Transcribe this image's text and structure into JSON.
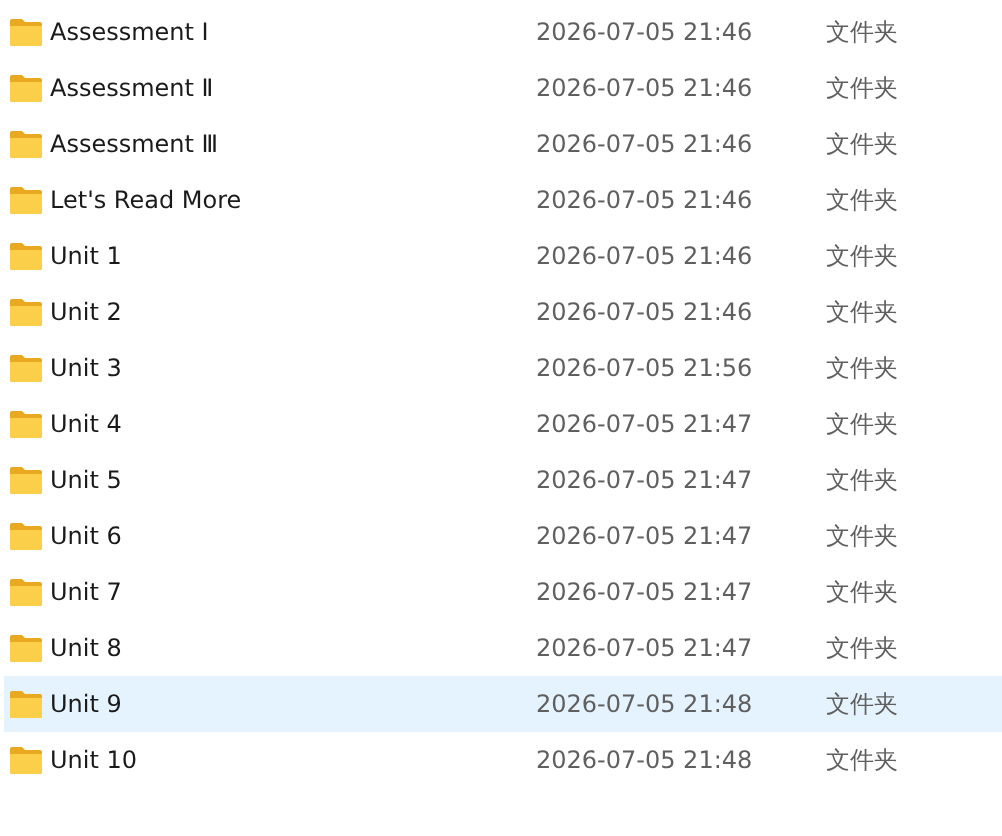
{
  "files": [
    {
      "name": "Assessment Ⅰ",
      "modified": "2026-07-05 21:46",
      "type": "文件夹",
      "selected": false
    },
    {
      "name": "Assessment Ⅱ",
      "modified": "2026-07-05 21:46",
      "type": "文件夹",
      "selected": false
    },
    {
      "name": "Assessment Ⅲ",
      "modified": "2026-07-05 21:46",
      "type": "文件夹",
      "selected": false
    },
    {
      "name": "Let's Read More",
      "modified": "2026-07-05 21:46",
      "type": "文件夹",
      "selected": false
    },
    {
      "name": "Unit 1",
      "modified": "2026-07-05 21:46",
      "type": "文件夹",
      "selected": false
    },
    {
      "name": "Unit 2",
      "modified": "2026-07-05 21:46",
      "type": "文件夹",
      "selected": false
    },
    {
      "name": "Unit 3",
      "modified": "2026-07-05 21:56",
      "type": "文件夹",
      "selected": false
    },
    {
      "name": "Unit 4",
      "modified": "2026-07-05 21:47",
      "type": "文件夹",
      "selected": false
    },
    {
      "name": "Unit 5",
      "modified": "2026-07-05 21:47",
      "type": "文件夹",
      "selected": false
    },
    {
      "name": "Unit 6",
      "modified": "2026-07-05 21:47",
      "type": "文件夹",
      "selected": false
    },
    {
      "name": "Unit 7",
      "modified": "2026-07-05 21:47",
      "type": "文件夹",
      "selected": false
    },
    {
      "name": "Unit 8",
      "modified": "2026-07-05 21:47",
      "type": "文件夹",
      "selected": false
    },
    {
      "name": "Unit 9",
      "modified": "2026-07-05 21:48",
      "type": "文件夹",
      "selected": true
    },
    {
      "name": "Unit 10",
      "modified": "2026-07-05 21:48",
      "type": "文件夹",
      "selected": false
    }
  ]
}
